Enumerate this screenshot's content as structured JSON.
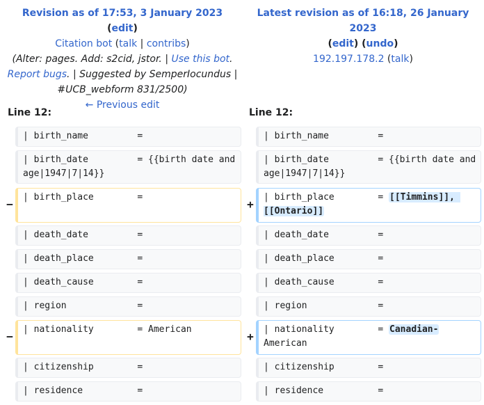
{
  "left_header": {
    "title": "Revision as of 17:53, 3 January 2023",
    "edit": "edit",
    "user": "Citation bot",
    "talk": "talk",
    "contribs": "contribs",
    "summary_pre": "(Alter: pages. Add: s2cid, jstor. | ",
    "use_bot": "Use this bot",
    "report_bugs": "Report bugs",
    "summary_post": ". | Suggested by SemperIocundus | #UCB_webform 831/2500)",
    "previous": "← Previous edit"
  },
  "right_header": {
    "title": "Latest revision as of 16:18, 26 January 2023",
    "edit": "edit",
    "undo": "undo",
    "user": "192.197.178.2",
    "talk": "talk"
  },
  "left_line_label": "Line 12:",
  "right_line_label": "Line 12:",
  "rows": [
    {
      "left": "| birth_name         =",
      "right": "| birth_name         ="
    },
    {
      "left": "| birth_date         = {{birth date and age|1947|7|14}}",
      "right": "| birth_date         = {{birth date and age|1947|7|14}}"
    },
    {
      "left": "| birth_place        =",
      "right": "| birth_place        = ",
      "right_ins": "[[Timmins]], [[Ontario]]",
      "changed": true
    },
    {
      "left": "| death_date         =",
      "right": "| death_date         ="
    },
    {
      "left": "| death_place        =",
      "right": "| death_place        ="
    },
    {
      "left": "| death_cause        =",
      "right": "| death_cause        ="
    },
    {
      "left": "| region             =",
      "right": "| region             ="
    },
    {
      "left": "| nationality        = American",
      "right": "| nationality        = ",
      "right_ins": "Canadian-",
      "right_tail": "American",
      "changed": true
    },
    {
      "left": "| citizenship        =",
      "right": "| citizenship        ="
    },
    {
      "left": "| residence          =",
      "right": "| residence          ="
    }
  ],
  "markers": {
    "minus": "−",
    "plus": "+"
  }
}
